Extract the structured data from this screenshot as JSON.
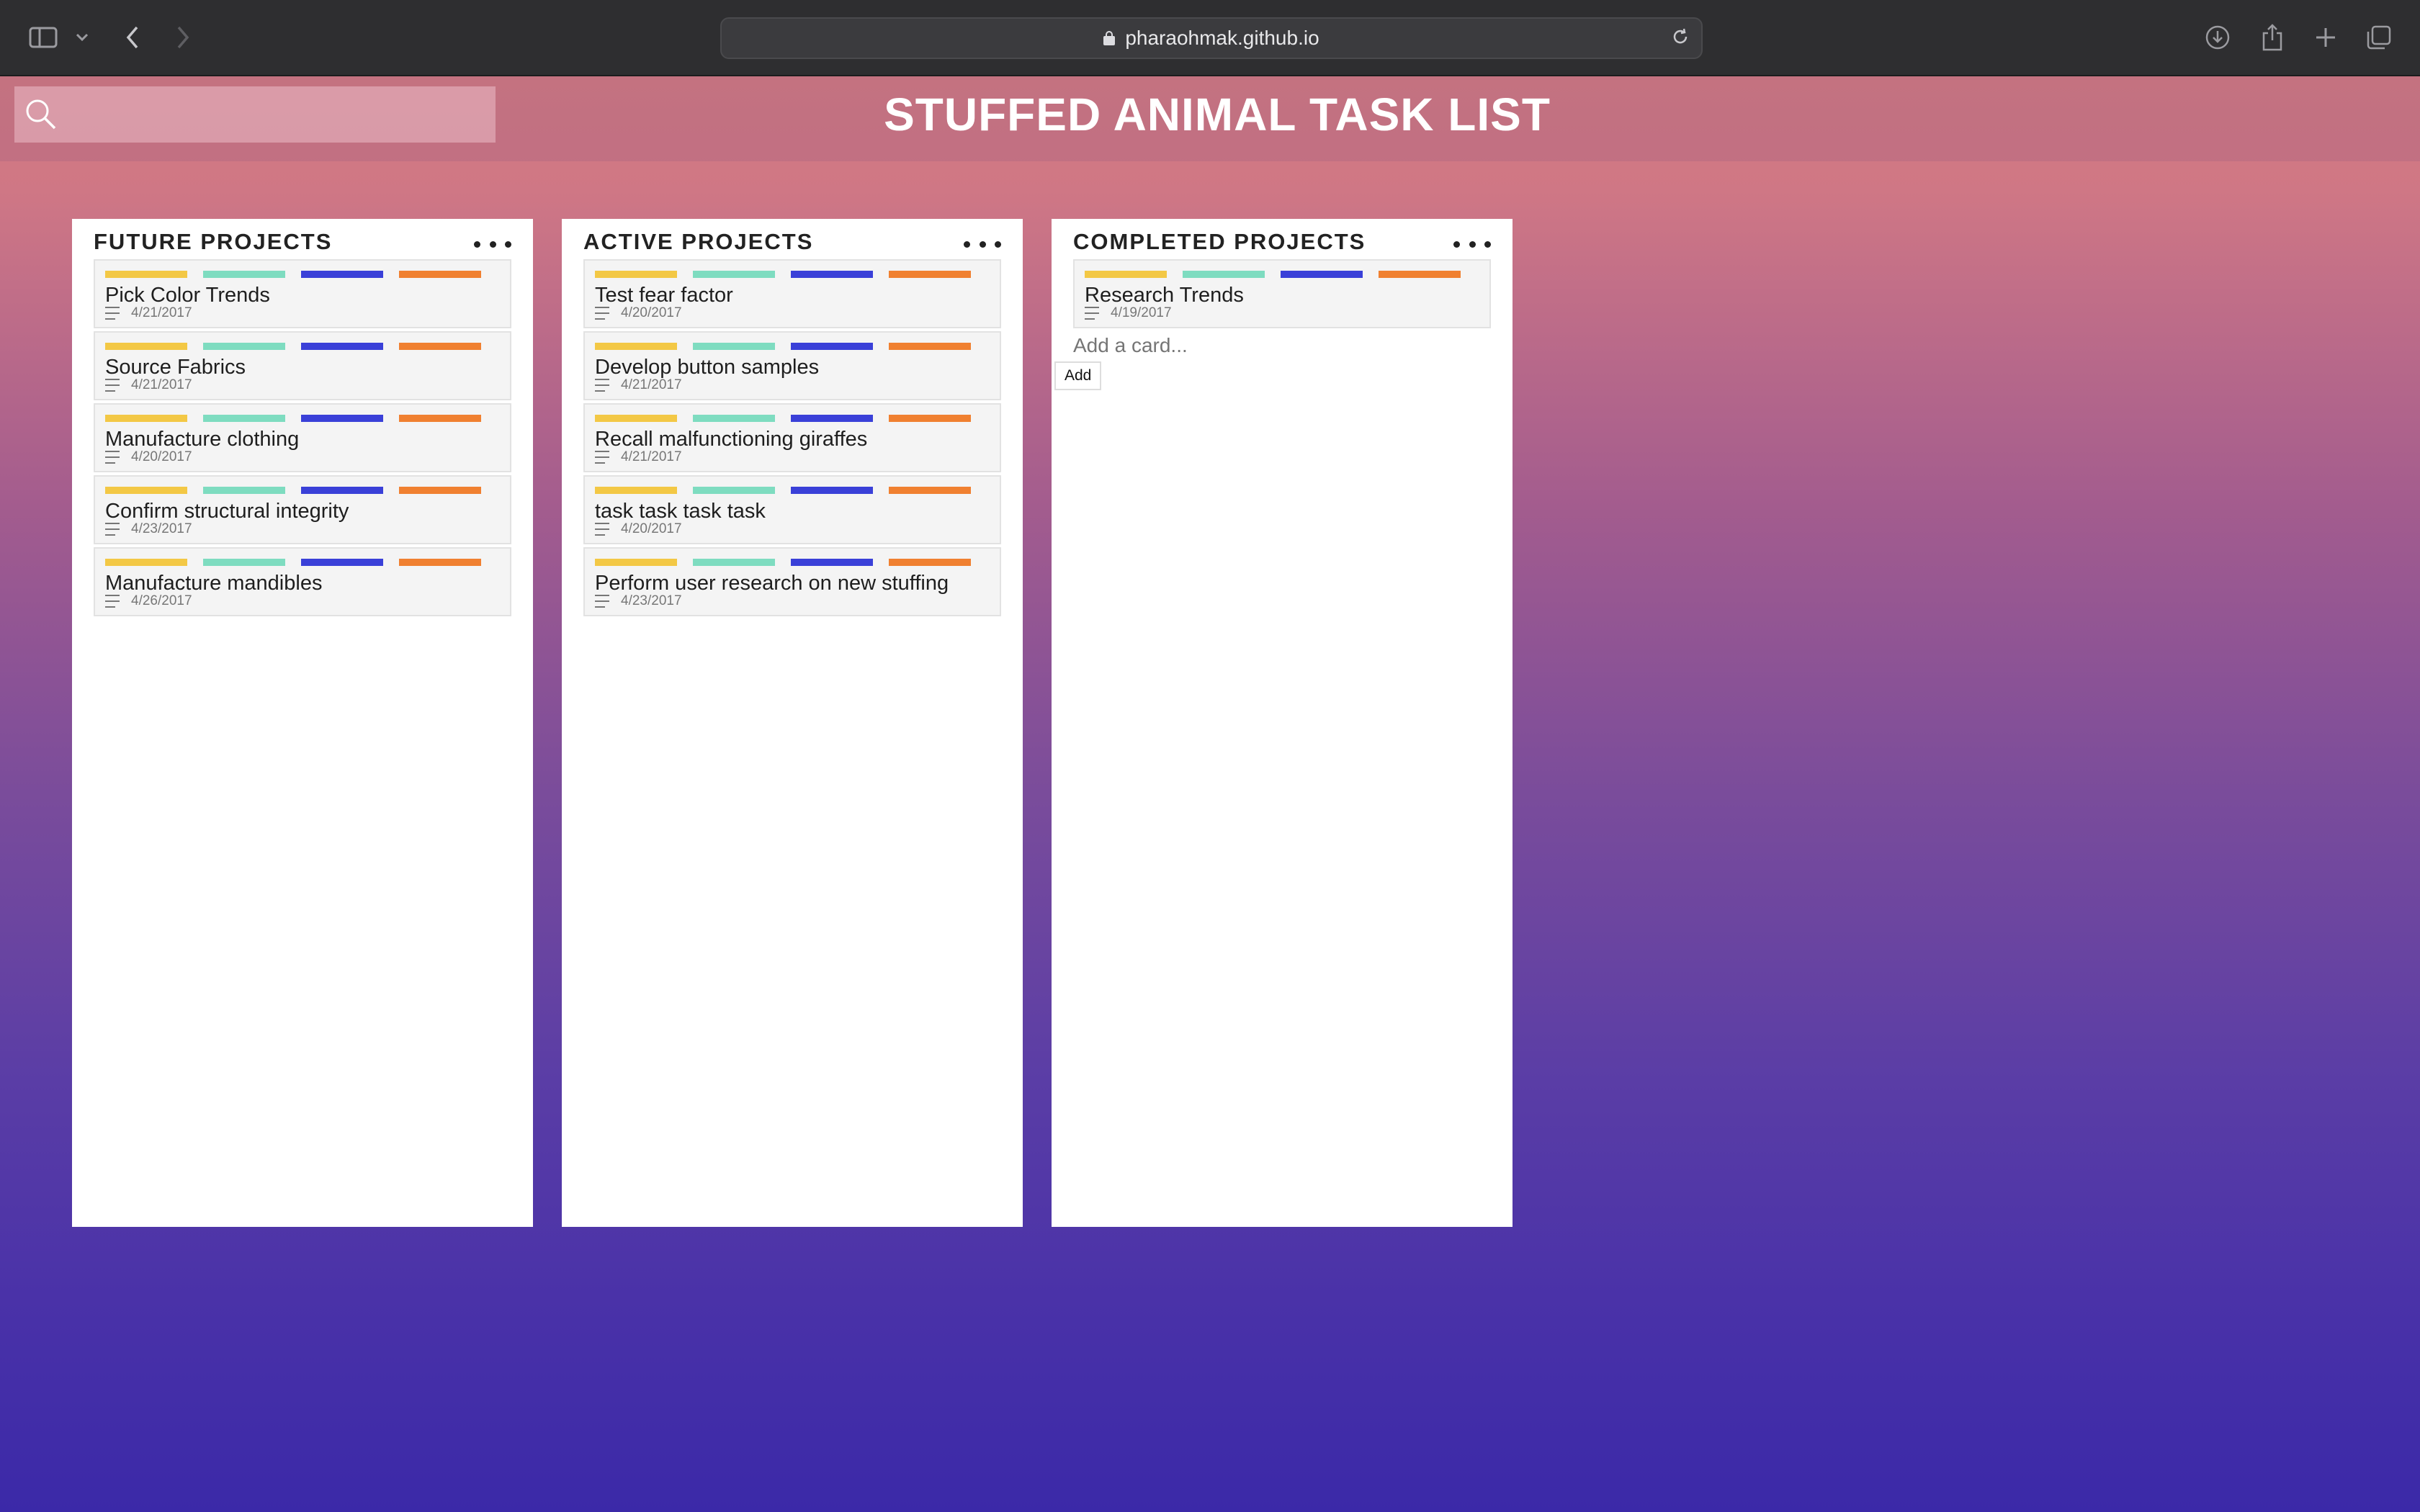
{
  "browser": {
    "url": "pharaohmak.github.io"
  },
  "app": {
    "title": "STUFFED ANIMAL TASK LIST",
    "search": {
      "placeholder": ""
    }
  },
  "label_colors": [
    "#f3c845",
    "#7edcc0",
    "#3a40d8",
    "#f08030"
  ],
  "columns": [
    {
      "title": "FUTURE PROJECTS",
      "cards": [
        {
          "title": "Pick Color Trends",
          "date": "4/21/2017"
        },
        {
          "title": "Source Fabrics",
          "date": "4/21/2017"
        },
        {
          "title": "Manufacture clothing",
          "date": "4/20/2017"
        },
        {
          "title": "Confirm structural integrity",
          "date": "4/23/2017"
        },
        {
          "title": "Manufacture mandibles",
          "date": "4/26/2017"
        }
      ]
    },
    {
      "title": "ACTIVE PROJECTS",
      "cards": [
        {
          "title": "Test fear factor",
          "date": "4/20/2017"
        },
        {
          "title": "Develop button samples",
          "date": "4/21/2017"
        },
        {
          "title": "Recall malfunctioning giraffes",
          "date": "4/21/2017"
        },
        {
          "title": "task task task task",
          "date": "4/20/2017"
        },
        {
          "title": "Perform user research on new stuffing",
          "date": "4/23/2017"
        }
      ]
    },
    {
      "title": "COMPLETED PROJECTS",
      "cards": [
        {
          "title": "Research Trends",
          "date": "4/19/2017"
        }
      ],
      "add_card_placeholder": "Add a card...",
      "add_button_label": "Add"
    }
  ]
}
